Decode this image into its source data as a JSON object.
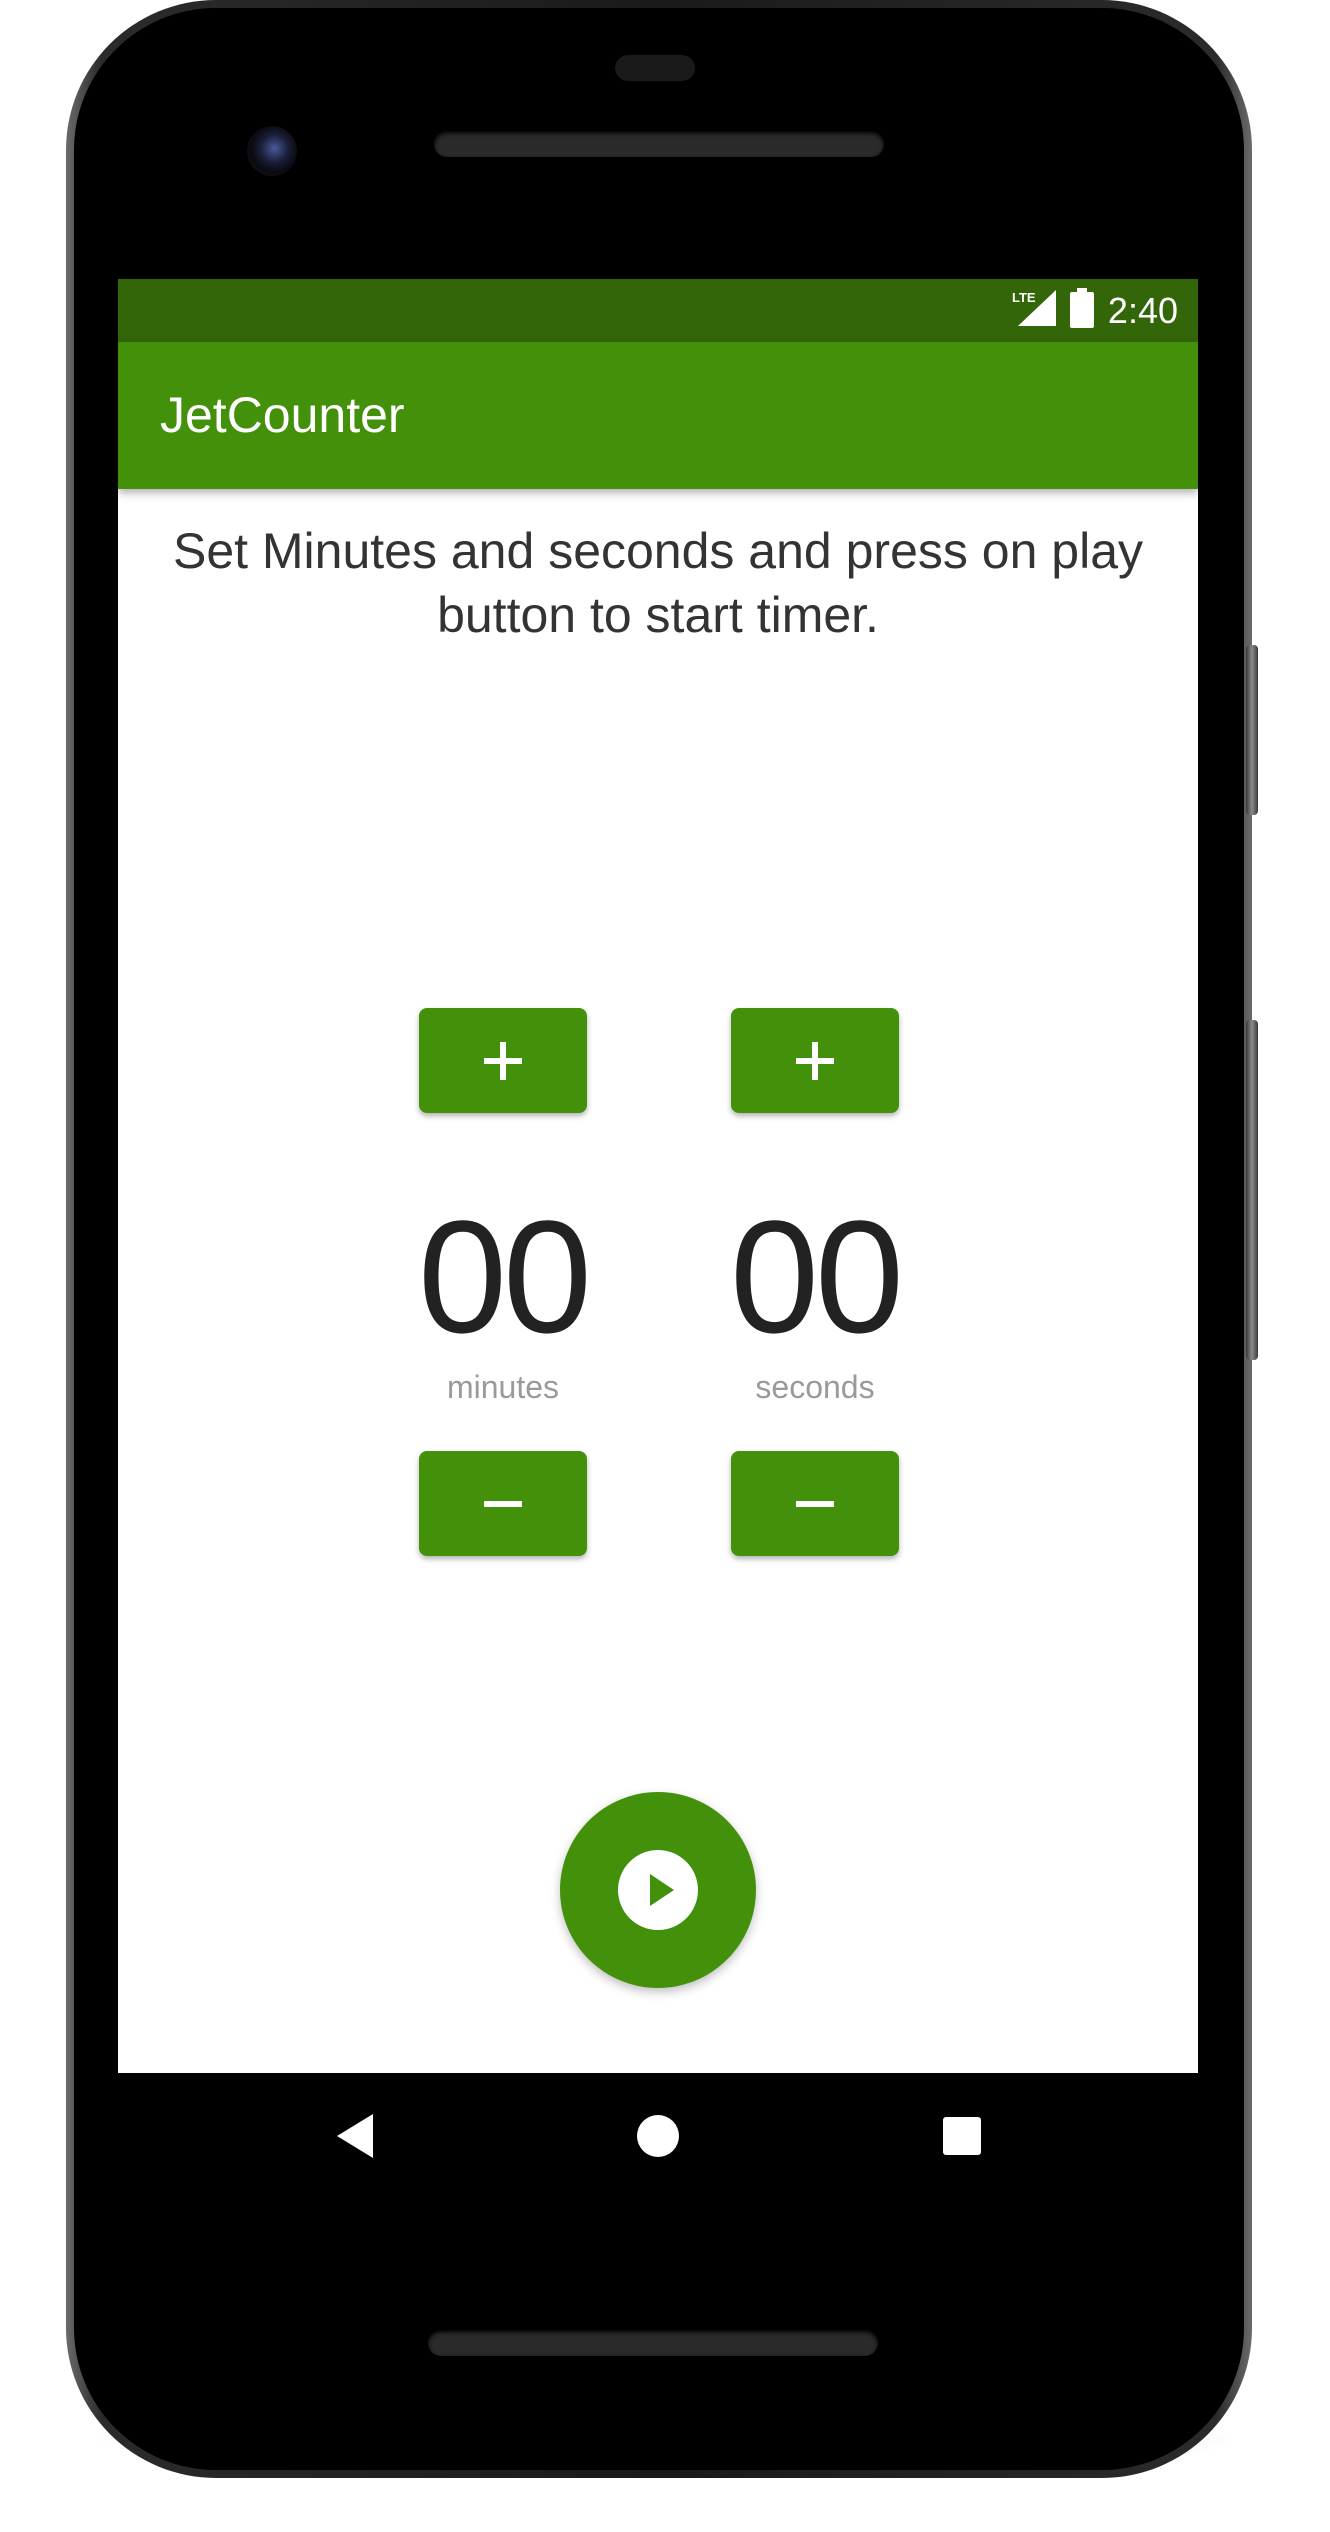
{
  "status_bar": {
    "network_label": "LTE",
    "time": "2:40"
  },
  "app_bar": {
    "title": "JetCounter"
  },
  "main": {
    "instructions": "Set Minutes and seconds and press on play button to start timer.",
    "minutes": {
      "value": "00",
      "label": "minutes",
      "increment_icon": "plus-icon",
      "decrement_icon": "minus-icon"
    },
    "seconds": {
      "value": "00",
      "label": "seconds",
      "increment_icon": "plus-icon",
      "decrement_icon": "minus-icon"
    },
    "play_icon": "play-circle-icon"
  },
  "navigation": {
    "back_icon": "back-triangle-icon",
    "home_icon": "home-circle-icon",
    "recents_icon": "recents-square-icon"
  },
  "colors": {
    "status_bar": "#336608",
    "primary": "#43910a",
    "text_dark": "#222222",
    "text_muted": "#9a9a9a",
    "nav_bar": "#000000"
  }
}
